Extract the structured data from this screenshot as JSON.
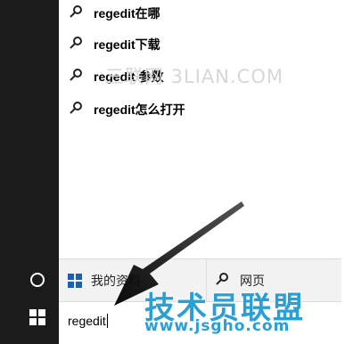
{
  "suggestions": [
    {
      "label": "regedit在哪"
    },
    {
      "label": "regedit下载"
    },
    {
      "label": "regedit 参数"
    },
    {
      "label": "regedit怎么打开"
    }
  ],
  "watermark": "三联网 3LIAN.COM",
  "filters": {
    "my_docs": "我的资料",
    "web": "网页"
  },
  "search": {
    "value": "regedit"
  },
  "brand": {
    "name": "技术员联盟",
    "url": "www.jsgho.com"
  },
  "colors": {
    "taskbar": "#1b1b1b",
    "windows_blue": "#1a5fb4",
    "brand_blue": "#2a9fd6"
  }
}
